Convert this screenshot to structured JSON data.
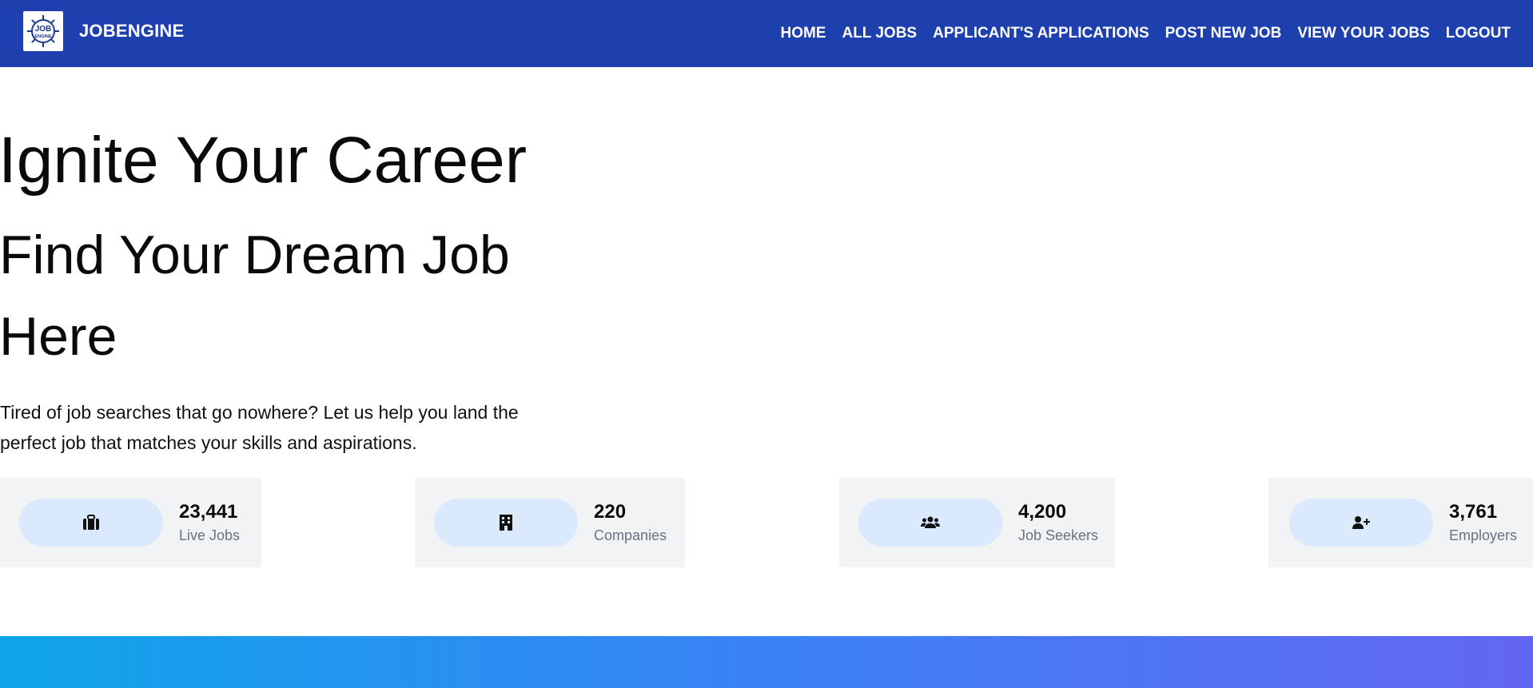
{
  "brand": {
    "name": "JOBENGINE",
    "logo_text_top": "JOB",
    "logo_text_bottom": "ENGINE",
    "logo_icon": "gear-icon"
  },
  "nav": {
    "items": [
      {
        "label": "HOME"
      },
      {
        "label": "ALL JOBS"
      },
      {
        "label": "APPLICANT'S APPLICATIONS"
      },
      {
        "label": "POST NEW JOB"
      },
      {
        "label": "VIEW YOUR JOBS"
      },
      {
        "label": "LOGOUT"
      }
    ]
  },
  "hero": {
    "title": "Ignite Your Career",
    "subtitle": "Find Your Dream Job Here",
    "description": "Tired of job searches that go nowhere? Let us help you land the perfect job that matches your skills and aspirations."
  },
  "stats": [
    {
      "value": "23,441",
      "label": "Live Jobs",
      "icon": "briefcase-icon"
    },
    {
      "value": "220",
      "label": "Companies",
      "icon": "building-icon"
    },
    {
      "value": "4,200",
      "label": "Job Seekers",
      "icon": "users-icon"
    },
    {
      "value": "3,761",
      "label": "Employers",
      "icon": "user-plus-icon"
    }
  ],
  "colors": {
    "navbar": "#1e40af",
    "stat_card_bg": "#f1f3f5",
    "icon_pill_bg": "#dbe9fd",
    "gradient_start": "#0ea5e9",
    "gradient_end": "#6366f1"
  }
}
